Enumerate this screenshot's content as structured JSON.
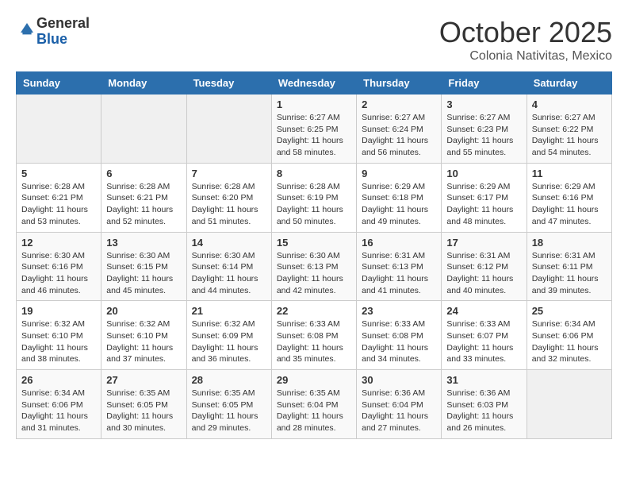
{
  "header": {
    "logo_general": "General",
    "logo_blue": "Blue",
    "month_title": "October 2025",
    "location": "Colonia Nativitas, Mexico"
  },
  "weekdays": [
    "Sunday",
    "Monday",
    "Tuesday",
    "Wednesday",
    "Thursday",
    "Friday",
    "Saturday"
  ],
  "weeks": [
    [
      {
        "day": "",
        "info": ""
      },
      {
        "day": "",
        "info": ""
      },
      {
        "day": "",
        "info": ""
      },
      {
        "day": "1",
        "info": "Sunrise: 6:27 AM\nSunset: 6:25 PM\nDaylight: 11 hours\nand 58 minutes."
      },
      {
        "day": "2",
        "info": "Sunrise: 6:27 AM\nSunset: 6:24 PM\nDaylight: 11 hours\nand 56 minutes."
      },
      {
        "day": "3",
        "info": "Sunrise: 6:27 AM\nSunset: 6:23 PM\nDaylight: 11 hours\nand 55 minutes."
      },
      {
        "day": "4",
        "info": "Sunrise: 6:27 AM\nSunset: 6:22 PM\nDaylight: 11 hours\nand 54 minutes."
      }
    ],
    [
      {
        "day": "5",
        "info": "Sunrise: 6:28 AM\nSunset: 6:21 PM\nDaylight: 11 hours\nand 53 minutes."
      },
      {
        "day": "6",
        "info": "Sunrise: 6:28 AM\nSunset: 6:21 PM\nDaylight: 11 hours\nand 52 minutes."
      },
      {
        "day": "7",
        "info": "Sunrise: 6:28 AM\nSunset: 6:20 PM\nDaylight: 11 hours\nand 51 minutes."
      },
      {
        "day": "8",
        "info": "Sunrise: 6:28 AM\nSunset: 6:19 PM\nDaylight: 11 hours\nand 50 minutes."
      },
      {
        "day": "9",
        "info": "Sunrise: 6:29 AM\nSunset: 6:18 PM\nDaylight: 11 hours\nand 49 minutes."
      },
      {
        "day": "10",
        "info": "Sunrise: 6:29 AM\nSunset: 6:17 PM\nDaylight: 11 hours\nand 48 minutes."
      },
      {
        "day": "11",
        "info": "Sunrise: 6:29 AM\nSunset: 6:16 PM\nDaylight: 11 hours\nand 47 minutes."
      }
    ],
    [
      {
        "day": "12",
        "info": "Sunrise: 6:30 AM\nSunset: 6:16 PM\nDaylight: 11 hours\nand 46 minutes."
      },
      {
        "day": "13",
        "info": "Sunrise: 6:30 AM\nSunset: 6:15 PM\nDaylight: 11 hours\nand 45 minutes."
      },
      {
        "day": "14",
        "info": "Sunrise: 6:30 AM\nSunset: 6:14 PM\nDaylight: 11 hours\nand 44 minutes."
      },
      {
        "day": "15",
        "info": "Sunrise: 6:30 AM\nSunset: 6:13 PM\nDaylight: 11 hours\nand 42 minutes."
      },
      {
        "day": "16",
        "info": "Sunrise: 6:31 AM\nSunset: 6:13 PM\nDaylight: 11 hours\nand 41 minutes."
      },
      {
        "day": "17",
        "info": "Sunrise: 6:31 AM\nSunset: 6:12 PM\nDaylight: 11 hours\nand 40 minutes."
      },
      {
        "day": "18",
        "info": "Sunrise: 6:31 AM\nSunset: 6:11 PM\nDaylight: 11 hours\nand 39 minutes."
      }
    ],
    [
      {
        "day": "19",
        "info": "Sunrise: 6:32 AM\nSunset: 6:10 PM\nDaylight: 11 hours\nand 38 minutes."
      },
      {
        "day": "20",
        "info": "Sunrise: 6:32 AM\nSunset: 6:10 PM\nDaylight: 11 hours\nand 37 minutes."
      },
      {
        "day": "21",
        "info": "Sunrise: 6:32 AM\nSunset: 6:09 PM\nDaylight: 11 hours\nand 36 minutes."
      },
      {
        "day": "22",
        "info": "Sunrise: 6:33 AM\nSunset: 6:08 PM\nDaylight: 11 hours\nand 35 minutes."
      },
      {
        "day": "23",
        "info": "Sunrise: 6:33 AM\nSunset: 6:08 PM\nDaylight: 11 hours\nand 34 minutes."
      },
      {
        "day": "24",
        "info": "Sunrise: 6:33 AM\nSunset: 6:07 PM\nDaylight: 11 hours\nand 33 minutes."
      },
      {
        "day": "25",
        "info": "Sunrise: 6:34 AM\nSunset: 6:06 PM\nDaylight: 11 hours\nand 32 minutes."
      }
    ],
    [
      {
        "day": "26",
        "info": "Sunrise: 6:34 AM\nSunset: 6:06 PM\nDaylight: 11 hours\nand 31 minutes."
      },
      {
        "day": "27",
        "info": "Sunrise: 6:35 AM\nSunset: 6:05 PM\nDaylight: 11 hours\nand 30 minutes."
      },
      {
        "day": "28",
        "info": "Sunrise: 6:35 AM\nSunset: 6:05 PM\nDaylight: 11 hours\nand 29 minutes."
      },
      {
        "day": "29",
        "info": "Sunrise: 6:35 AM\nSunset: 6:04 PM\nDaylight: 11 hours\nand 28 minutes."
      },
      {
        "day": "30",
        "info": "Sunrise: 6:36 AM\nSunset: 6:04 PM\nDaylight: 11 hours\nand 27 minutes."
      },
      {
        "day": "31",
        "info": "Sunrise: 6:36 AM\nSunset: 6:03 PM\nDaylight: 11 hours\nand 26 minutes."
      },
      {
        "day": "",
        "info": ""
      }
    ]
  ]
}
